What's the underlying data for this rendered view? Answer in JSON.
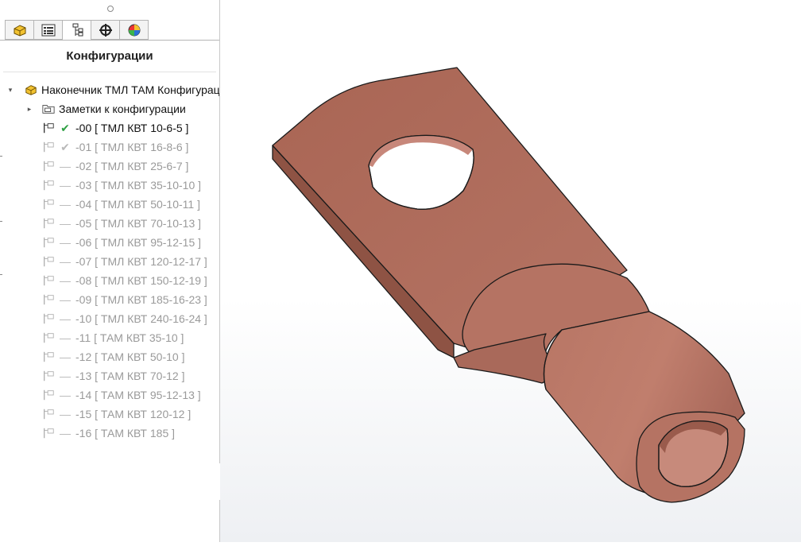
{
  "panel": {
    "tabs": [
      {
        "icon": "feature-manager-icon",
        "active": false
      },
      {
        "icon": "property-manager-icon",
        "active": false
      },
      {
        "icon": "configuration-manager-icon",
        "active": true
      },
      {
        "icon": "dimxpert-icon",
        "active": false
      },
      {
        "icon": "display-manager-icon",
        "active": false
      }
    ],
    "title": "Конфигурации",
    "root_label": "Наконечник ТМЛ ТАМ Конфигурации",
    "notes_label": "Заметки к конфигурации",
    "configurations": [
      {
        "label": "-00 [ ТМЛ КВТ 10-6-5 ]",
        "active": true
      },
      {
        "label": "-01 [ ТМЛ КВТ 16-8-6 ]",
        "active": false,
        "status": "check"
      },
      {
        "label": "-02 [ ТМЛ КВТ 25-6-7 ]",
        "active": false
      },
      {
        "label": "-03 [ ТМЛ КВТ 35-10-10 ]",
        "active": false
      },
      {
        "label": "-04 [ ТМЛ КВТ 50-10-11 ]",
        "active": false
      },
      {
        "label": "-05 [ ТМЛ КВТ 70-10-13 ]",
        "active": false
      },
      {
        "label": "-06 [ ТМЛ КВТ 95-12-15 ]",
        "active": false
      },
      {
        "label": "-07 [ ТМЛ КВТ 120-12-17 ]",
        "active": false
      },
      {
        "label": "-08 [ ТМЛ КВТ 150-12-19 ]",
        "active": false
      },
      {
        "label": "-09 [ ТМЛ КВТ 185-16-23 ]",
        "active": false
      },
      {
        "label": "-10 [ ТМЛ КВТ 240-16-24 ]",
        "active": false
      },
      {
        "label": "-11 [ ТАМ КВТ 35-10 ]",
        "active": false
      },
      {
        "label": "-12 [ ТАМ КВТ 50-10 ]",
        "active": false
      },
      {
        "label": "-13 [ ТАМ КВТ 70-12 ]",
        "active": false
      },
      {
        "label": "-14 [ ТАМ КВТ 95-12-13 ]",
        "active": false
      },
      {
        "label": "-15 [ ТАМ КВТ 120-12 ]",
        "active": false
      },
      {
        "label": "-16 [ ТАМ КВТ 185 ]",
        "active": false
      }
    ]
  },
  "colors": {
    "copper": "#b06e5d",
    "copper_dark": "#8f5446",
    "copper_light": "#c48574",
    "check_active": "#2ea043"
  }
}
